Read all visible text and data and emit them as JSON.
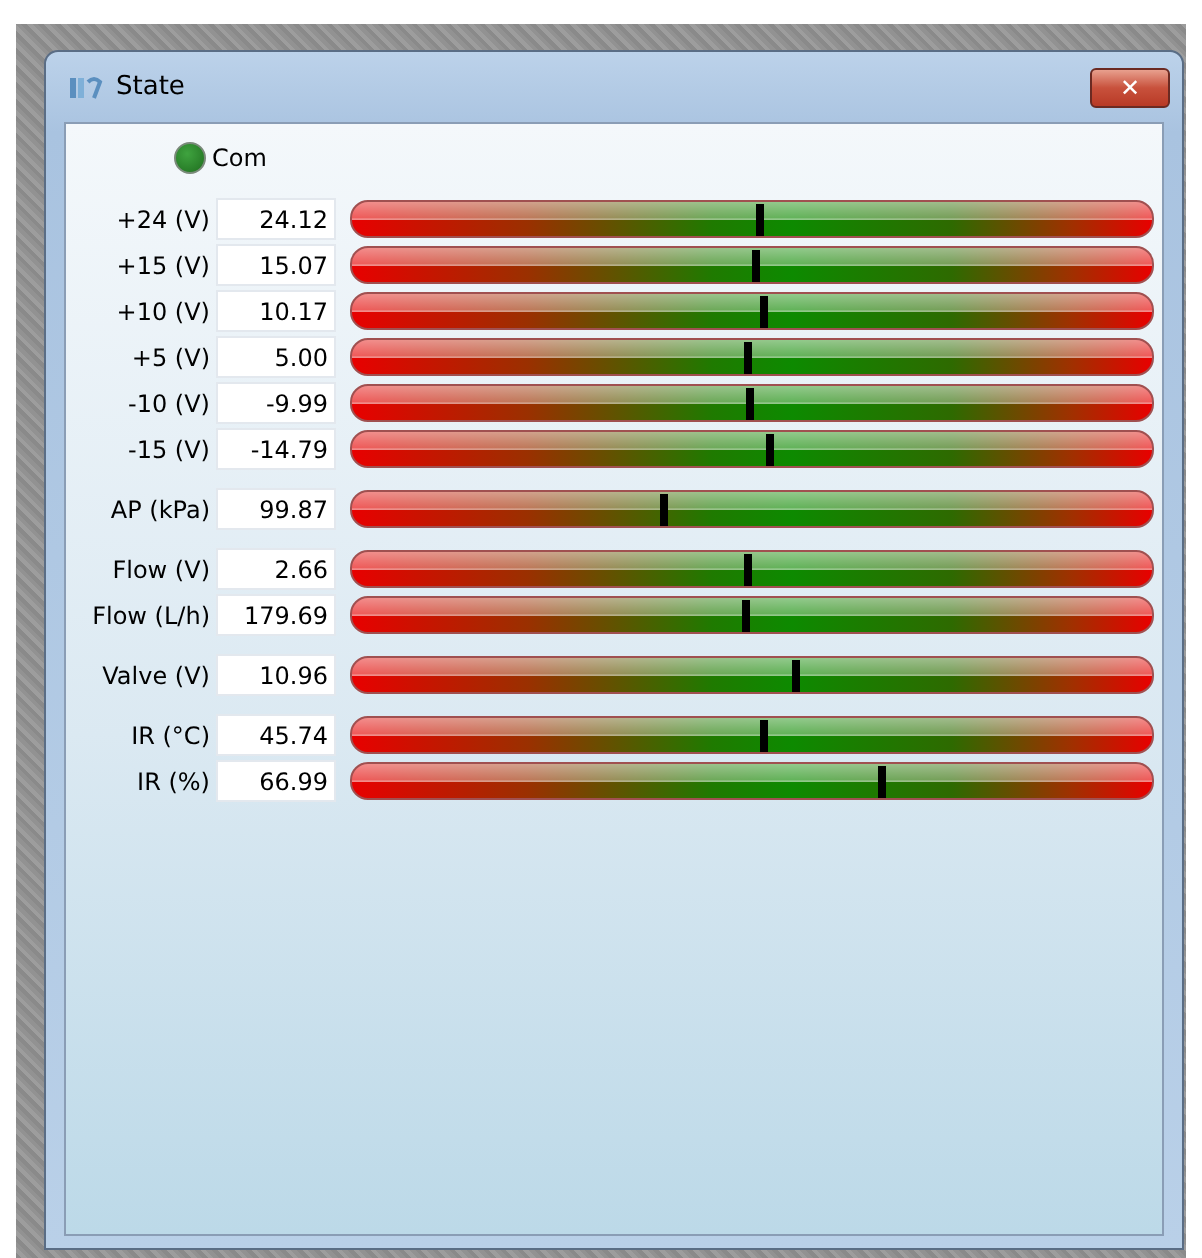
{
  "window": {
    "title": "State",
    "close_label": "✕"
  },
  "indicator": {
    "label": "Com",
    "on": true
  },
  "groups": [
    {
      "rows": [
        {
          "label": "+24 (V)",
          "value": "24.12",
          "level": 0.51
        },
        {
          "label": "+15 (V)",
          "value": "15.07",
          "level": 0.505
        },
        {
          "label": "+10 (V)",
          "value": "10.17",
          "level": 0.515
        },
        {
          "label": "+5 (V)",
          "value": "5.00",
          "level": 0.495
        },
        {
          "label": "-10 (V)",
          "value": "-9.99",
          "level": 0.498
        },
        {
          "label": "-15 (V)",
          "value": "-14.79",
          "level": 0.522
        }
      ]
    },
    {
      "rows": [
        {
          "label": "AP (kPa)",
          "value": "99.87",
          "level": 0.39
        }
      ]
    },
    {
      "rows": [
        {
          "label": "Flow (V)",
          "value": "2.66",
          "level": 0.495
        },
        {
          "label": "Flow (L/h)",
          "value": "179.69",
          "level": 0.492
        }
      ]
    },
    {
      "rows": [
        {
          "label": "Valve (V)",
          "value": "10.96",
          "level": 0.555
        }
      ]
    },
    {
      "rows": [
        {
          "label": "IR (°C)",
          "value": "45.74",
          "level": 0.515
        },
        {
          "label": "IR (%)",
          "value": "66.99",
          "level": 0.662
        }
      ]
    }
  ]
}
